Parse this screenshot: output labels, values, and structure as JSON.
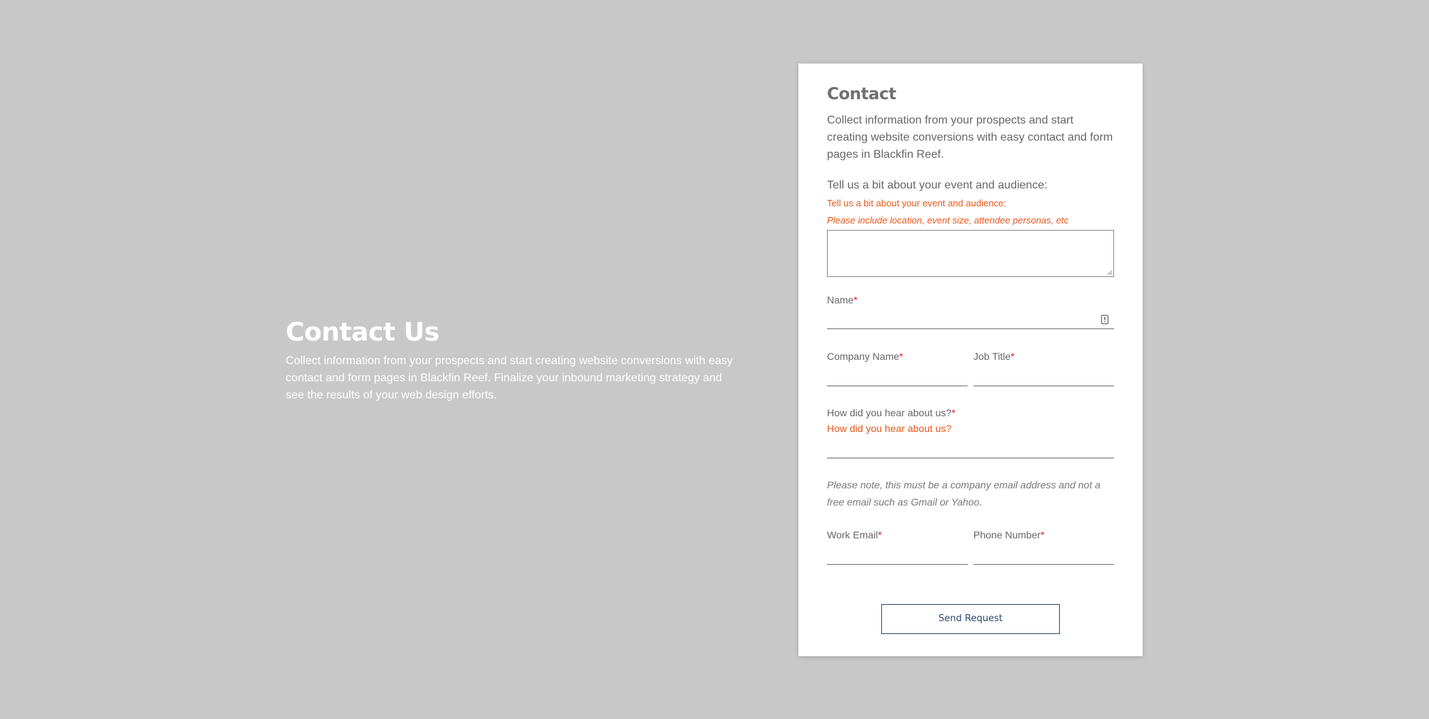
{
  "hero": {
    "title": "Contact Us",
    "description": "Collect information from your prospects and start creating website conversions with easy contact and form pages in Blackfin Reef. Finalize your inbound marketing strategy and see the results of your web design efforts."
  },
  "form": {
    "title": "Contact",
    "intro": "Collect information from your prospects and start creating website conversions with easy contact and form pages in Blackfin Reef.",
    "event": {
      "label": "Tell us a bit about your event and audience:",
      "help_1": "Tell us a bit about your event and audience:",
      "help_2": "Please include location, event size, attendee personas, etc",
      "value": ""
    },
    "name": {
      "label": "Name",
      "required_mark": "*",
      "value": ""
    },
    "company": {
      "label": "Company Name",
      "required_mark": "*",
      "value": ""
    },
    "job_title": {
      "label": "Job Title",
      "required_mark": "*",
      "value": ""
    },
    "hear": {
      "label": "How did you hear about us?",
      "required_mark": "*",
      "help": "How did you hear about us?",
      "value": ""
    },
    "note": "Please note, this must be a company email address and not a free email such as Gmail or Yahoo.",
    "email": {
      "label": "Work Email",
      "required_mark": "*",
      "value": ""
    },
    "phone": {
      "label": "Phone Number",
      "required_mark": "*",
      "value": ""
    },
    "submit_label": "Send Request"
  },
  "colors": {
    "background": "#c8c8c8",
    "help_text": "#e8581c",
    "required": "#e01b1b",
    "button_border": "#2c4a73"
  },
  "icons": {
    "contact_autofill": "contact-card-icon",
    "textarea_resize": "resize-grip-icon"
  }
}
